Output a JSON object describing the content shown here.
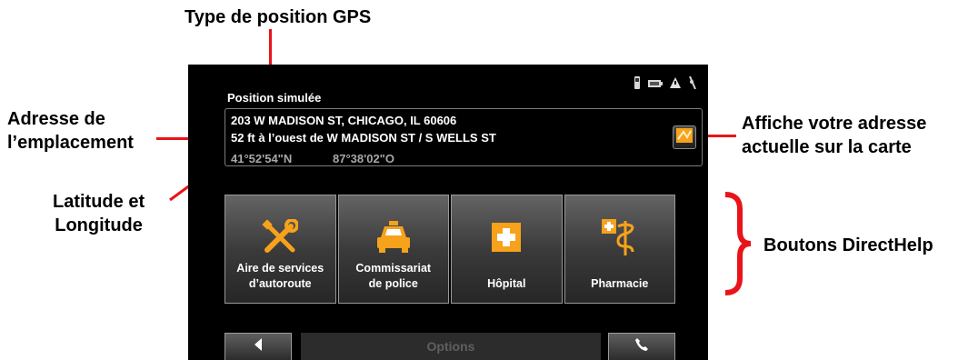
{
  "annotations": {
    "gps_type": "Type de position GPS",
    "address_line1": "Adresse de",
    "address_line2": "l’emplacement",
    "latlon_line1": "Latitude et",
    "latlon_line2": "Longitude",
    "map_line1": "Affiche votre adresse",
    "map_line2": "actuelle sur la carte",
    "directhelp": "Boutons DirectHelp"
  },
  "screen": {
    "position_label": "Position simulée",
    "address_line1": "203 W MADISON ST, CHICAGO, IL 60606",
    "address_line2": "52 ft à l’ouest de W MADISON ST / S WELLS ST",
    "latitude": "41°52'54\"N",
    "longitude": "87°38'02\"O",
    "help_buttons": [
      {
        "line1": "Aire de services",
        "line2": "d’autoroute",
        "icon": "tools-icon"
      },
      {
        "line1": "Commissariat",
        "line2": "de police",
        "icon": "police-car-icon"
      },
      {
        "line1": "Hôpital",
        "line2": "",
        "icon": "hospital-icon"
      },
      {
        "line1": "Pharmacie",
        "line2": "",
        "icon": "pharmacy-icon"
      }
    ],
    "options_label": "Options",
    "status_icons": [
      "phone-icon",
      "battery-icon",
      "warning-icon",
      "gps-signal-icon"
    ]
  },
  "colors": {
    "callout_line": "#e8141a",
    "brace": "#e8141a",
    "icon_orange": "#f7a21b"
  }
}
